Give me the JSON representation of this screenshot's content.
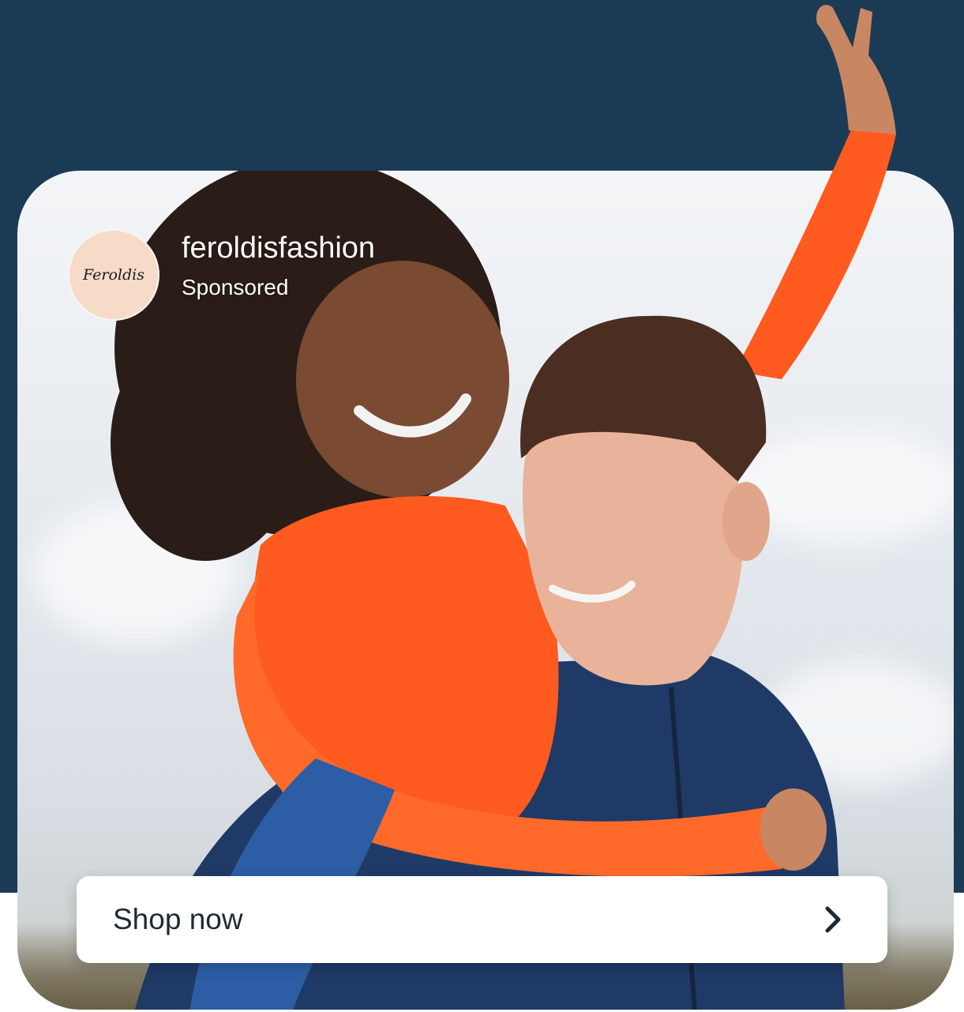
{
  "ad": {
    "account_name": "feroldisfashion",
    "sponsored_label": "Sponsored",
    "avatar_logo_text": "Feroldis",
    "cta_label": "Shop now"
  },
  "icons": {
    "cta_icon": "chevron-right-icon"
  },
  "colors": {
    "background_top": "#1b3a55",
    "card_background": "#ffffff",
    "avatar_background": "#f6dcc8",
    "cta_text": "#1c2b33",
    "sweater_orange": "#ff5a1f",
    "jacket_navy": "#1f3a66"
  }
}
